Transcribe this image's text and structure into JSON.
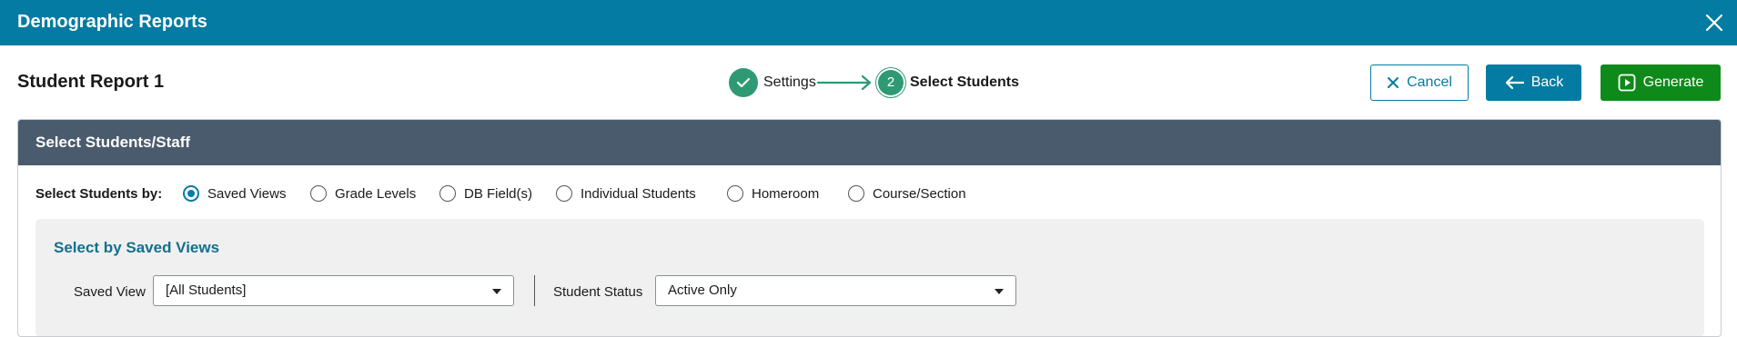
{
  "window": {
    "title": "Demographic Reports"
  },
  "header": {
    "report_name": "Student Report 1",
    "steps": [
      {
        "label": "Settings",
        "status": "complete"
      },
      {
        "number": "2",
        "label": "Select Students",
        "status": "current"
      }
    ],
    "buttons": {
      "cancel": "Cancel",
      "back": "Back",
      "generate": "Generate"
    }
  },
  "panel": {
    "title": "Select Students/Staff",
    "select_by_label": "Select Students by:",
    "options": [
      "Saved Views",
      "Grade Levels",
      "DB Field(s)",
      "Individual Students",
      "Homeroom",
      "Course/Section"
    ],
    "selected_option": "Saved Views",
    "subpanel": {
      "title": "Select by Saved Views",
      "saved_view_label": "Saved View",
      "saved_view_value": "[All Students]",
      "student_status_label": "Student Status",
      "student_status_value": "Active Only"
    }
  },
  "colors": {
    "brand": "#037ba2",
    "success": "#2e9a73",
    "generate": "#0e8a1a",
    "panel_header": "#4a5b6e"
  },
  "icons": [
    "close-icon",
    "check-icon",
    "arrow-right-icon",
    "x-icon",
    "arrow-left-icon",
    "play-icon",
    "caret-down-icon"
  ]
}
